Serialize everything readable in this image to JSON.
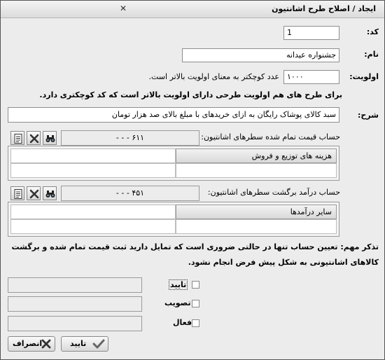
{
  "window": {
    "title": "ایجاد / اصلاح طرح اشانتیون"
  },
  "fields": {
    "code_label": "کد:",
    "code_value": "1",
    "name_label": "نام:",
    "name_value": "جشنواره عیدانه",
    "priority_label": "اولویت:",
    "priority_value": "۱۰۰۰",
    "priority_hint": "عدد کوچکتر به معنای اولویت بالاتر است.",
    "priority_note": "برای طرح های هم اولویت طرحی دارای اولویت بالاتر است که کد کوچکتری دارد.",
    "desc_label": "شرح:",
    "desc_value": "سبد کالای پوشاک رایگان به ازای خریدهای با مبلغ بالای صد هزار تومان"
  },
  "account1": {
    "label": "حساب قیمت تمام شده سطرهای اشانتیون:",
    "value": "۶۱۱ -  -  -",
    "grid_header": "هزینه های توزیع و فروش"
  },
  "account2": {
    "label": "حساب درآمد برگشت سطرهای اشانتیون:",
    "value": "۴۵۱ -  -  -",
    "grid_header": "سایر درآمدها"
  },
  "warning": {
    "line1": "تذکر مهم: تعیین حساب تنها در حالتی ضروری است که تمایل دارید ثبت قیمت تمام شده و برگشت",
    "line2": "کالاهای اشانتیونی به شکل پیش فرض انجام نشود."
  },
  "checks": {
    "confirm": "تایید",
    "approve": "تصویب",
    "active": "فعال"
  },
  "buttons": {
    "ok": "تایید",
    "cancel": "انصراف"
  }
}
